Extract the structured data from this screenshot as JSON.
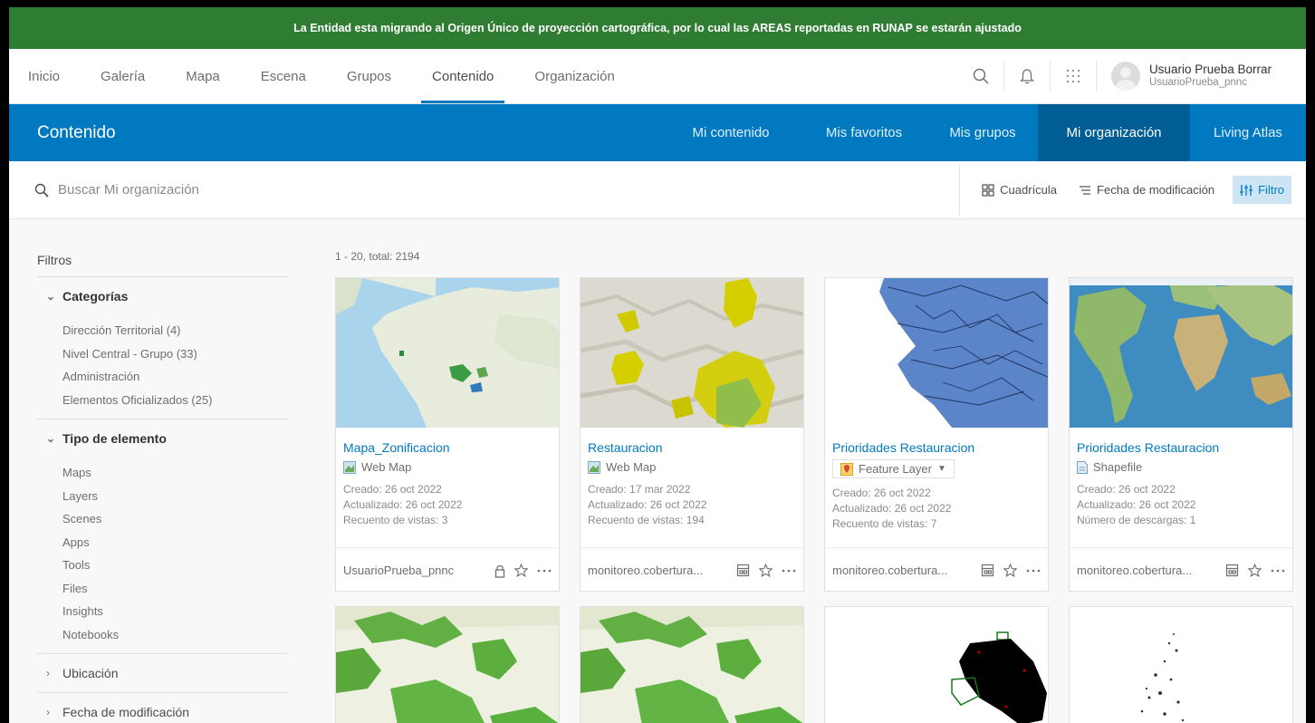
{
  "banner": {
    "text": "La Entidad esta migrando al Origen Único de proyección cartográfica, por lo cual las AREAS reportadas en RUNAP se estarán ajustado"
  },
  "topnav": {
    "links": [
      "Inicio",
      "Galería",
      "Mapa",
      "Escena",
      "Grupos",
      "Contenido",
      "Organización"
    ],
    "active": "Contenido",
    "icons": [
      "search-icon",
      "bell-icon",
      "apps-icon"
    ],
    "user": {
      "name": "Usuario Prueba Borrar",
      "login": "UsuarioPrueba_pnnc"
    }
  },
  "header": {
    "title": "Contenido",
    "tabs": [
      "Mi contenido",
      "Mis favoritos",
      "Mis grupos",
      "Mi organización",
      "Living Atlas"
    ],
    "active": "Mi organización"
  },
  "search": {
    "placeholder": "Buscar Mi organización"
  },
  "toolbar": {
    "grid_label": "Cuadrícula",
    "sort_label": "Fecha de modificación",
    "filter_label": "Filtro"
  },
  "sidebar": {
    "title": "Filtros",
    "categories": {
      "label": "Categorías",
      "items": [
        "Dirección Territorial  (4)",
        "Nivel Central - Grupo  (33)",
        "Administración",
        "Elementos Oficializados  (25)"
      ]
    },
    "types": {
      "label": "Tipo de elemento",
      "items": [
        "Maps",
        "Layers",
        "Scenes",
        "Apps",
        "Tools",
        "Files",
        "Insights",
        "Notebooks"
      ]
    },
    "location": {
      "label": "Ubicación"
    },
    "modified": {
      "label": "Fecha de modificación"
    }
  },
  "results": {
    "count": "1 - 20, total: 2194"
  },
  "cards": [
    {
      "title": "Mapa_Zonificacion",
      "type": "Web Map",
      "created": "Creado: 26 oct 2022",
      "updated": "Actualizado: 26 oct 2022",
      "stat": "Recuento de vistas: 3",
      "owner": "UsuarioPrueba_pnnc",
      "share_icon": "lock-icon"
    },
    {
      "title": "Restauracion",
      "type": "Web Map",
      "created": "Creado: 17 mar 2022",
      "updated": "Actualizado: 26 oct 2022",
      "stat": "Recuento de vistas: 194",
      "owner": "monitoreo.cobertura...",
      "share_icon": "building-icon"
    },
    {
      "title": "Prioridades Restauracion",
      "type": "Feature Layer",
      "created": "Creado: 26 oct 2022",
      "updated": "Actualizado: 26 oct 2022",
      "stat": "Recuento de vistas: 7",
      "owner": "monitoreo.cobertura...",
      "share_icon": "building-icon"
    },
    {
      "title": "Prioridades Restauracion",
      "type": "Shapefile",
      "created": "Creado: 26 oct 2022",
      "updated": "Actualizado: 26 oct 2022",
      "stat": "Número de descargas: 1",
      "owner": "monitoreo.cobertura...",
      "share_icon": "building-icon"
    }
  ],
  "colors": {
    "banner": "#2e7d32",
    "brand_blue": "#0079c1",
    "active_tab": "#005e95"
  }
}
